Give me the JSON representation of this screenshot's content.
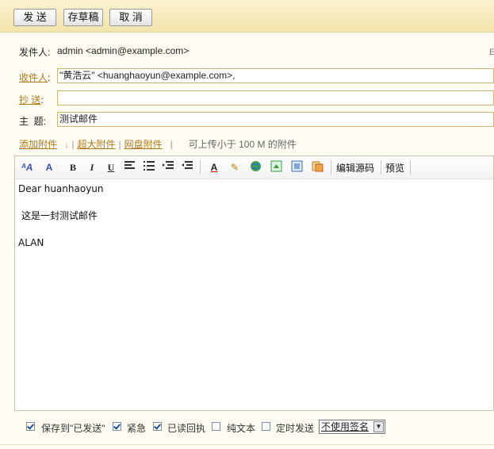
{
  "toolbar_buttons": {
    "send": "发 送",
    "save_draft": "存草稿",
    "cancel": "取 消"
  },
  "header": {
    "from_label": "发件人:",
    "from_value": "admin <admin@example.com>",
    "to_label": "收件人",
    "to_colon": ":",
    "to_value": "\"黄浩云\" <huanghaoyun@example.com>,",
    "cc_label": "抄 送",
    "cc_colon": ":",
    "cc_value": "",
    "subject_label": "主  题:",
    "subject_value": "测试邮件",
    "right_mark": "E"
  },
  "attachments": {
    "add": "添加附件",
    "big": "超大附件",
    "disk": "网盘附件",
    "hint": "可上传小于 100 M 的附件"
  },
  "editor_toolbar": {
    "icons": [
      "font-style-icon",
      "font-size-icon",
      "bold-icon",
      "italic-icon",
      "underline-icon",
      "align-icon",
      "list-icon",
      "indent-icon",
      "outdent-icon",
      "font-color-icon",
      "highlight-icon",
      "link-icon",
      "image-icon",
      "picture-icon",
      "paste-icon"
    ],
    "bold": "B",
    "italic": "I",
    "underline": "U",
    "edit_source": "编辑源码",
    "preview": "预览"
  },
  "body": {
    "line1": "Dear huanhaoyun",
    "line2": "这是一封测试邮件",
    "line3": "ALAN"
  },
  "options": {
    "save_sent": {
      "label": "保存到\"已发送\"",
      "checked": true
    },
    "urgent": {
      "label": "紧急",
      "checked": true
    },
    "read_receipt": {
      "label": "已读回执",
      "checked": true
    },
    "plain_text": {
      "label": "纯文本",
      "checked": false
    },
    "scheduled": {
      "label": "定时发送",
      "checked": false
    },
    "signature_selected": "不使用签名"
  },
  "colors": {
    "accent_link": "#b07a1c",
    "topbar": "#f3e3ab",
    "border": "#c9b676"
  }
}
